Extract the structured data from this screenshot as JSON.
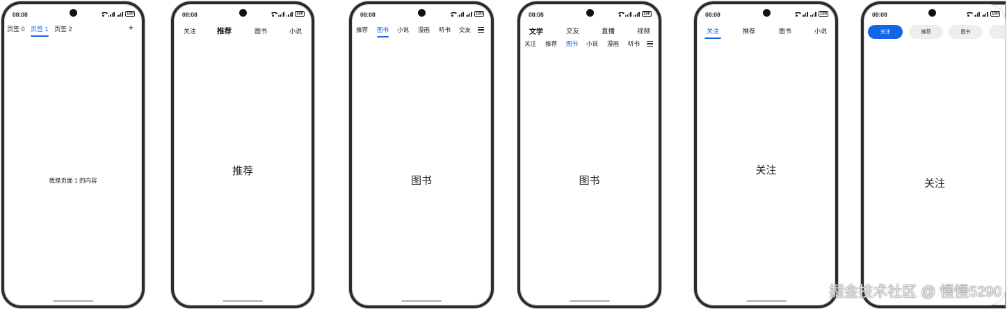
{
  "status": {
    "time": "08:08",
    "battery": "100"
  },
  "phones": [
    {
      "tabs": [
        "页签 0",
        "页签 1",
        "页签 2"
      ],
      "active_tab": "页签 1",
      "action_icon": "plus-icon",
      "content": "我是页面 1 的内容"
    },
    {
      "tabs": [
        "关注",
        "推荐",
        "图书",
        "小说"
      ],
      "active_tab": "推荐",
      "content": "推荐"
    },
    {
      "tabs": [
        "推荐",
        "图书",
        "小说",
        "漫画",
        "听书",
        "交友"
      ],
      "active_tab": "图书",
      "action_icon": "menu-icon",
      "content": "图书"
    },
    {
      "top_tabs": [
        "文学",
        "交友",
        "直播",
        "视频"
      ],
      "active_top_tab": "文学",
      "tabs": [
        "关注",
        "推荐",
        "图书",
        "小说",
        "漫画",
        "听书"
      ],
      "active_tab": "图书",
      "action_icon": "menu-icon",
      "content": "图书"
    },
    {
      "tabs": [
        "关注",
        "推荐",
        "图书",
        "小说"
      ],
      "active_tab": "关注",
      "content": "关注"
    },
    {
      "tabs": [
        "关注",
        "推荐",
        "图书"
      ],
      "active_tab": "关注",
      "style": "pill",
      "content": "关注"
    }
  ],
  "watermark": "掘金技术社区 @ 慢慢5290",
  "colors": {
    "accent": "#1a66e0",
    "pill_active": "#1264e8",
    "pill_inactive": "#eeeeee"
  }
}
